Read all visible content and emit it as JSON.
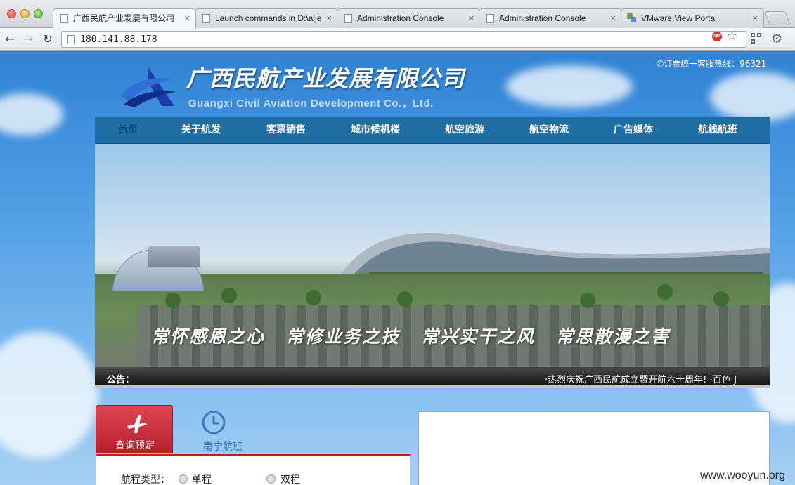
{
  "browser": {
    "tabs": [
      {
        "title": "广西民航产业发展有限公司",
        "close": "×",
        "active": true
      },
      {
        "title": "Launch commands in D:\\alje",
        "close": "×",
        "active": false
      },
      {
        "title": "Administration Console",
        "close": "×",
        "active": false
      },
      {
        "title": "Administration Console",
        "close": "×",
        "active": false
      },
      {
        "title": "VMware View Portal",
        "close": "×",
        "active": false
      }
    ],
    "url": "180.141.88.178",
    "abp_label": "ABP"
  },
  "header": {
    "hotline": "订票统一客服热线：96321",
    "company_cn": "广西民航产业发展有限公司",
    "company_en": "Guangxi Civil Aviation Development Co.，Ltd."
  },
  "nav": {
    "items": [
      {
        "label": "首页",
        "current": true
      },
      {
        "label": "关于航发"
      },
      {
        "label": "客票销售"
      },
      {
        "label": "城市候机楼"
      },
      {
        "label": "航空旅游"
      },
      {
        "label": "航空物流"
      },
      {
        "label": "广告媒体"
      },
      {
        "label": "航线航班"
      }
    ]
  },
  "banner": {
    "slogans": [
      "常怀感恩之心",
      "常修业务之技",
      "常兴实干之风",
      "常思散漫之害"
    ]
  },
  "notice": {
    "label": "公告：",
    "text": "·热烈庆祝广西民航成立暨开航六十周年!  ·百色-J"
  },
  "booking": {
    "tab_query": "查询预定",
    "tab_nanning": "南宁航班",
    "trip_type_label": "航程类型：",
    "option_oneway": "单程",
    "option_roundtrip": "双程"
  },
  "watermark": "www.wooyun.org",
  "colors": {
    "nav_bg": "#1f6ea6",
    "query_tab": "#c8202e",
    "sky": "#3f8fdc"
  }
}
